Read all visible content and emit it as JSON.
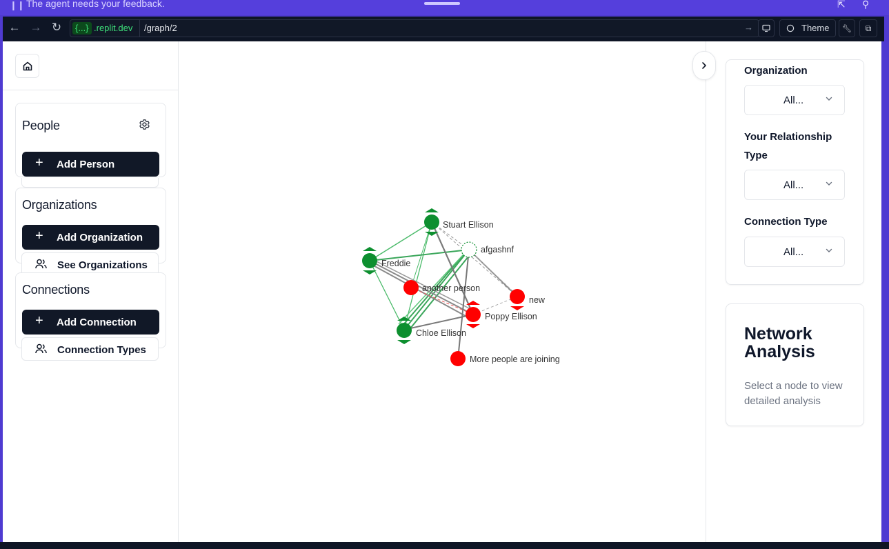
{
  "banner": {
    "message": "The agent needs your feedback."
  },
  "browser": {
    "domain_badge": "{...}",
    "domain_suffix": ".replit.dev",
    "path": "/graph/2",
    "theme_label": "Theme"
  },
  "sidebar": {
    "people": {
      "title": "People",
      "add_label": "Add Person"
    },
    "organizations": {
      "title": "Organizations",
      "add_label": "Add Organization",
      "see_label": "See Organizations"
    },
    "connections": {
      "title": "Connections",
      "add_label": "Add Connection",
      "types_label": "Connection Types"
    }
  },
  "graph": {
    "nodes": [
      {
        "id": "stuart",
        "label": "Stuart Ellison",
        "color": "#0d8f2f",
        "style": "person"
      },
      {
        "id": "afgashnf",
        "label": "afgashnf",
        "color": "#0d8f2f",
        "style": "dashed"
      },
      {
        "id": "freddie",
        "label": "Freddie",
        "color": "#0d8f2f",
        "style": "person"
      },
      {
        "id": "another",
        "label": "another person",
        "color": "#ff0000",
        "style": "plain"
      },
      {
        "id": "new",
        "label": "new",
        "color": "#ff0000",
        "style": "person"
      },
      {
        "id": "poppy",
        "label": "Poppy Ellison",
        "color": "#ff0000",
        "style": "person"
      },
      {
        "id": "chloe",
        "label": "Chloe Ellison",
        "color": "#0d8f2f",
        "style": "person"
      },
      {
        "id": "more",
        "label": "More people are joining",
        "color": "#ff0000",
        "style": "plain"
      }
    ]
  },
  "filters": {
    "organization": {
      "label": "Organization",
      "value": "All..."
    },
    "relationship": {
      "label": "Your Relationship Type",
      "value": "All..."
    },
    "connection": {
      "label": "Connection Type",
      "value": "All..."
    }
  },
  "analysis": {
    "title": "Network Analysis",
    "description": "Select a node to view detailed analysis"
  }
}
